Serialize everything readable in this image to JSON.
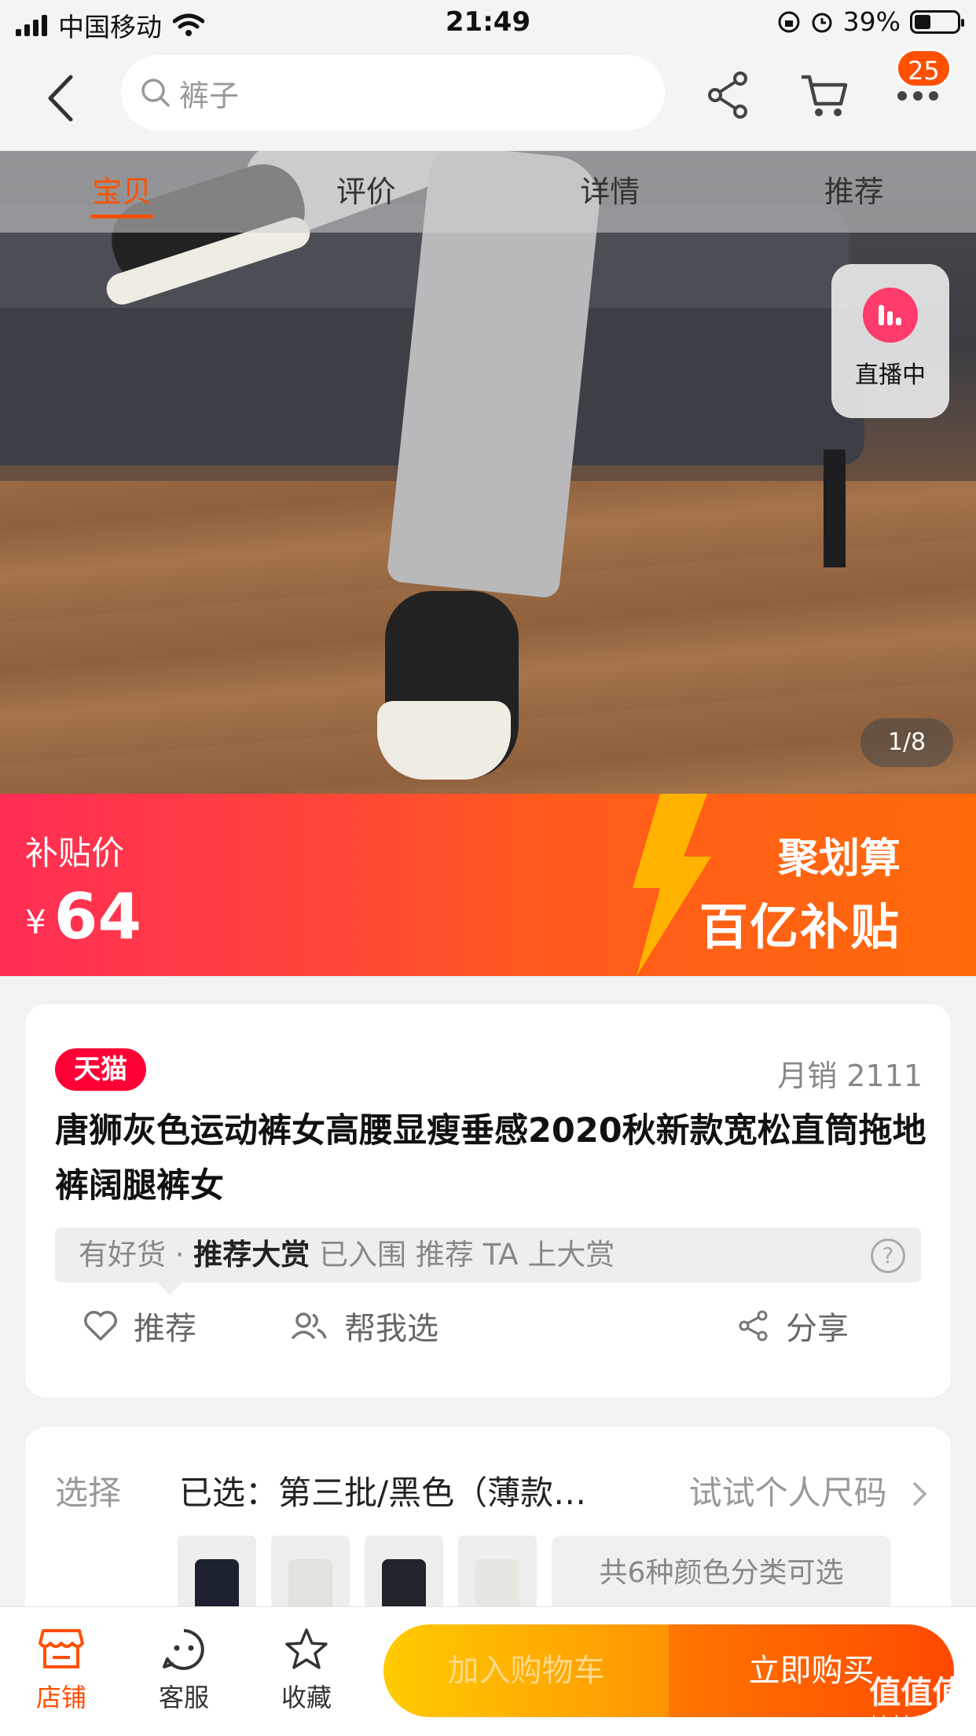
{
  "status": {
    "carrier": "中国移动",
    "time": "21:49",
    "battery": "39%"
  },
  "header": {
    "search_placeholder": "裤子",
    "cart_badge": "25"
  },
  "tabs": [
    {
      "label": "宝贝",
      "active": true
    },
    {
      "label": "评价",
      "active": false
    },
    {
      "label": "详情",
      "active": false
    },
    {
      "label": "推荐",
      "active": false
    }
  ],
  "live": {
    "label": "直播中"
  },
  "gallery": {
    "counter": "1/8"
  },
  "price": {
    "label": "补贴价",
    "currency": "¥",
    "value": "64",
    "promo_line1": "聚划算",
    "promo_line2": "百亿补贴"
  },
  "product": {
    "badge": "天猫",
    "sales": "月销 2111",
    "title": "唐狮灰色运动裤女高腰显瘦垂感2020秋新款宽松直筒拖地裤阔腿裤女",
    "haohuo_prefix": "有好货 · ",
    "haohuo_bold": "推荐大赏",
    "haohuo_suffix": " 已入围 推荐 TA 上大赏",
    "help": "?",
    "actions": {
      "recommend": "推荐",
      "help_choose": "帮我选",
      "share": "分享"
    }
  },
  "selection": {
    "label": "选择",
    "value": "已选：第三批/黑色（薄款…",
    "fit": "试试个人尺码",
    "colors_note": "共6种颜色分类可选"
  },
  "bottom": {
    "shop": "店铺",
    "service": "客服",
    "favorite": "收藏",
    "add_cart": "加入购物车",
    "buy_now": "立即购买"
  },
  "watermark": {
    "line1": "值值值",
    "line2": "zhizhizhi.com"
  },
  "colors": {
    "accent": "#ff5000",
    "tmall": "#ff0036"
  }
}
